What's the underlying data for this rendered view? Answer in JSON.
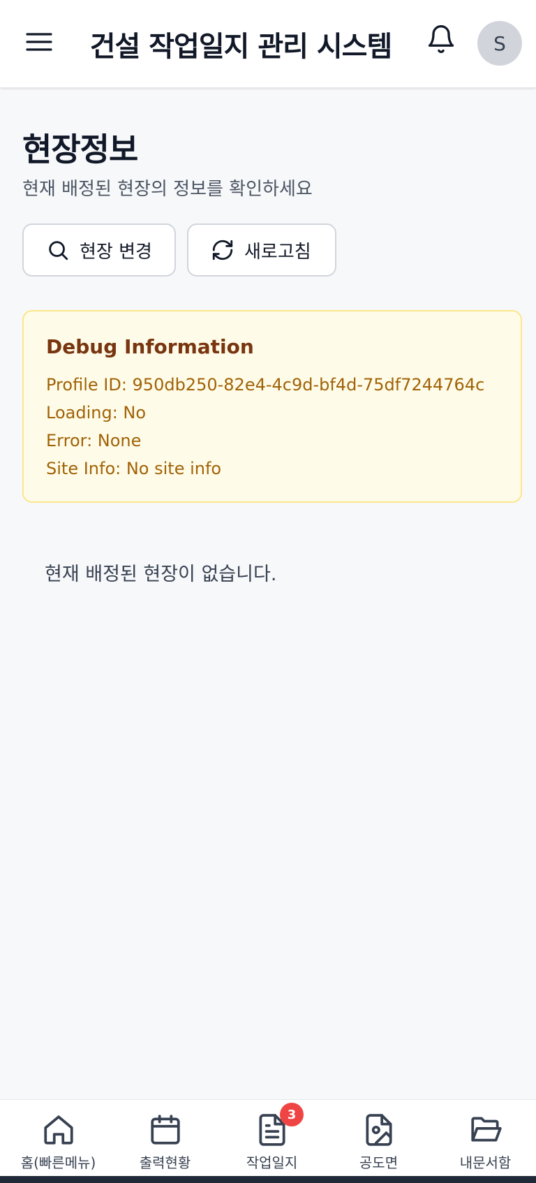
{
  "header": {
    "title": "건설 작업일지 관리 시스템",
    "avatar_initial": "S"
  },
  "page": {
    "title": "현장정보",
    "subtitle": "현재 배정된 현장의 정보를 확인하세요"
  },
  "actions": {
    "change_site_label": "현장 변경",
    "refresh_label": "새로고침"
  },
  "debug": {
    "title": "Debug Information",
    "profile_id": "Profile ID: 950db250-82e4-4c9d-bf4d-75df7244764c",
    "loading": "Loading: No",
    "error": "Error: None",
    "site_info": "Site Info: No site info"
  },
  "empty_message": "현재 배정된 현장이 없습니다.",
  "bottom_nav": {
    "items": [
      {
        "label": "홈(빠른메뉴)",
        "icon": "home-icon"
      },
      {
        "label": "출력현황",
        "icon": "calendar-icon"
      },
      {
        "label": "작업일지",
        "icon": "document-icon",
        "badge": "3"
      },
      {
        "label": "공도면",
        "icon": "image-file-icon"
      },
      {
        "label": "내문서함",
        "icon": "folder-open-icon"
      }
    ]
  },
  "colors": {
    "debug_bg": "#fefce8",
    "debug_border": "#fde68a",
    "debug_title": "#78350f",
    "debug_text": "#a16207",
    "badge": "#ef4444"
  }
}
